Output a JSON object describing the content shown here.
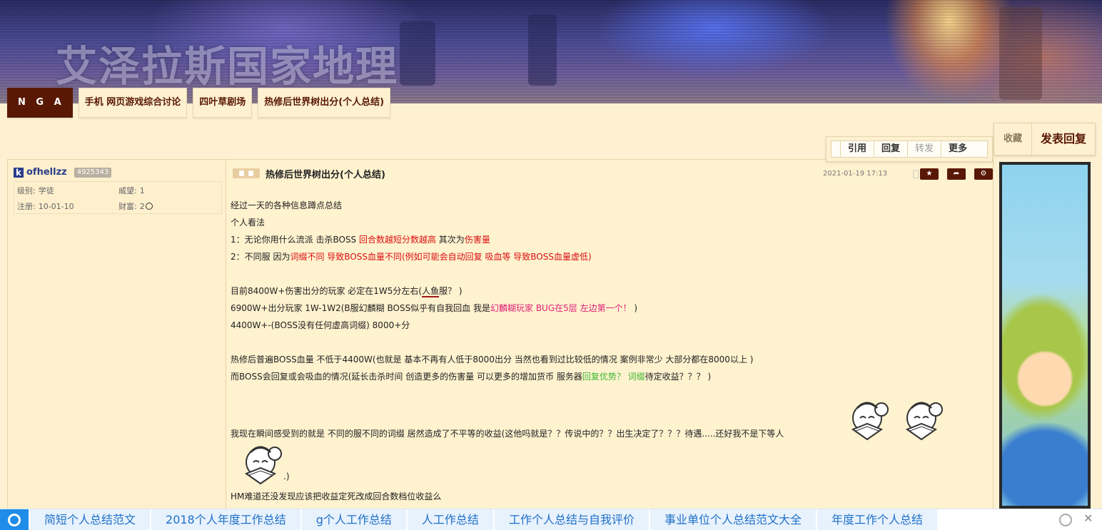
{
  "site": {
    "title": "艾泽拉斯国家地理"
  },
  "breadcrumbs": [
    "N G A",
    "手机 网页游戏综合讨论",
    "四叶草剧场",
    "热修后世界树出分(个人总结)"
  ],
  "actions": {
    "favorite": "收藏",
    "reply": "发表回复"
  },
  "toolbar": {
    "quote": "引用",
    "reply": "回复",
    "forward": "转发",
    "more": "更多"
  },
  "user": {
    "initial": "k",
    "name": "ofhellzz",
    "uid": "4925343",
    "level_label": "级别:",
    "level": "学徒",
    "prestige_label": "威望:",
    "prestige": "1",
    "reg_label": "注册:",
    "reg": "10-01-10",
    "wealth_label": "财富:",
    "wealth": "2"
  },
  "post": {
    "title": "热修后世界树出分(个人总结)",
    "date": "2021-01-19 17:13",
    "lines": {
      "l1": "经过一天的各种信息蹲点总结",
      "l2": "个人看法",
      "l3a": "1：无论你用什么流派 击杀BOSS ",
      "l3b": "回合数越短分数越高",
      "l3c": " 其次为",
      "l3d": "伤害量",
      "l4a": "2：不同服 因为",
      "l4b": "词缀不同 导致BOSS血量不同(例如可能会自动回复 吸血等 导致BOSS血量虚低)",
      "l5a": "目前8400W+伤害出分的玩家 必定在1W5分左右(",
      "l5b": "人鱼",
      "l5c": "服？ )",
      "l6a": "6900W+出分玩家 1W-1W2(B服幻麟糊 BOSS似乎有自我回血 我是",
      "l6b": "幻麟糊玩家 BUG在5层 左边第一个！",
      "l6c": " )",
      "l7": "4400W+-(BOSS没有任何虚高词缀) 8000+分",
      "l8": "热修后普遍BOSS血量 不低于4400W(也就是 基本不再有人低于8000出分 当然也看到过比较低的情况 案例非常少 大部分都在8000以上 )",
      "l9a": "而BOSS会回复或会吸血的情况(延长击杀时间 创造更多的伤害量 可以更多的增加货币 服务器",
      "l9b": "回复优势？ 词缀",
      "l9c": "待定收益？？？ )",
      "l10": "我现在瞬间感受到的就是 不同的服不同的词缀 居然造成了不平等的收益(这他吗就是？？传说中的？？出生决定了？？？待遇.....还好我不是下等人",
      "l11": ".)",
      "l12": "HM难道还没发现应该把收益定死改成回合数档位收益么"
    }
  },
  "bottombar": {
    "items": [
      "简短个人总结范文",
      "2018个人年度工作总结",
      "g个人工作总结",
      "人工作总结",
      "工作个人总结与自我评价",
      "事业单位个人总结范文大全",
      "年度工作个人总结"
    ]
  }
}
